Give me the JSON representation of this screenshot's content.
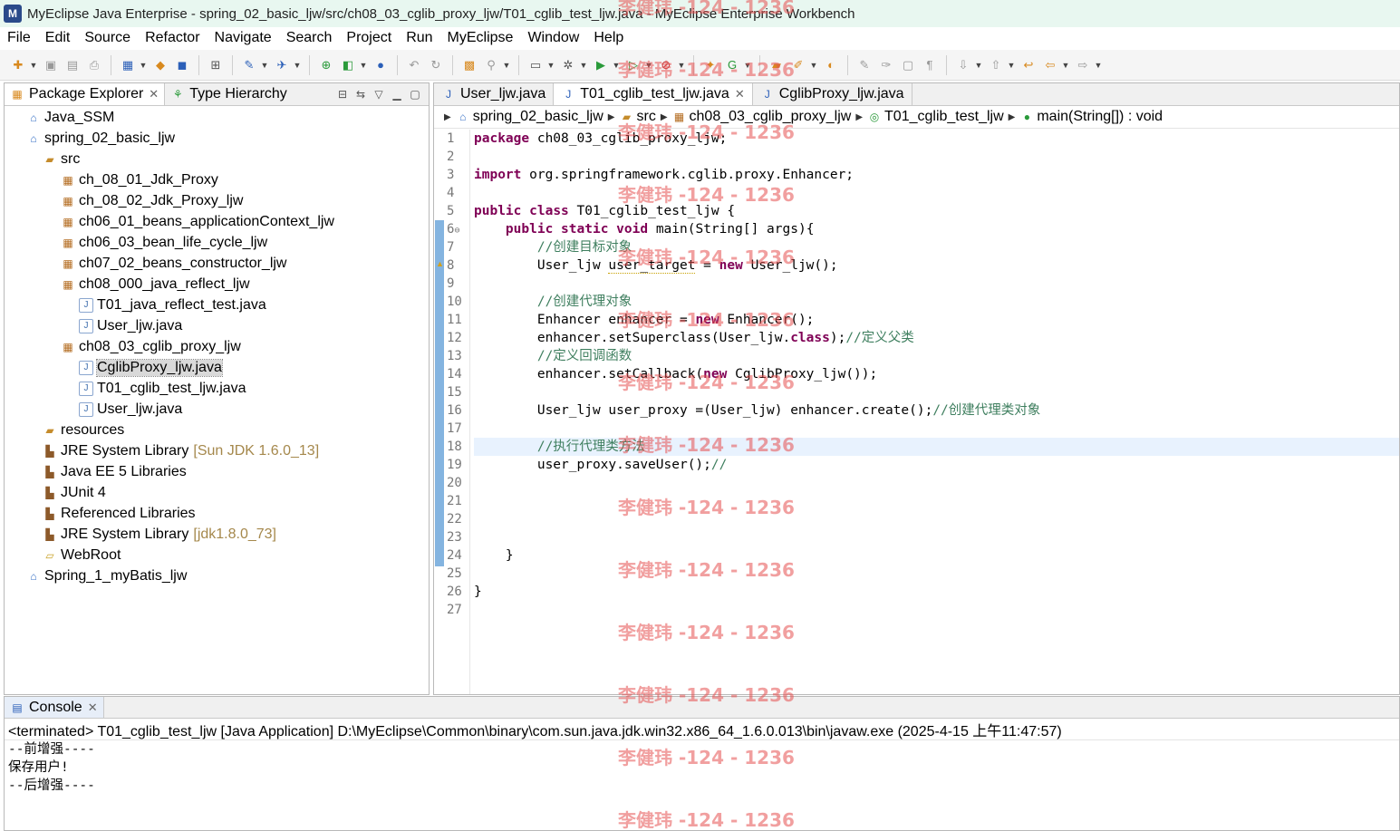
{
  "window": {
    "title": "MyEclipse Java Enterprise - spring_02_basic_ljw/src/ch08_03_cglib_proxy_ljw/T01_cglib_test_ljw.java - MyEclipse Enterprise Workbench"
  },
  "menu": [
    "File",
    "Edit",
    "Source",
    "Refactor",
    "Navigate",
    "Search",
    "Project",
    "Run",
    "MyEclipse",
    "Window",
    "Help"
  ],
  "left_view": {
    "tabs": [
      {
        "label": "Package Explorer",
        "icon": "package-explorer-icon",
        "active": true
      },
      {
        "label": "Type Hierarchy",
        "icon": "type-hierarchy-icon",
        "active": false
      }
    ],
    "tree": [
      {
        "label": "Java_SSM",
        "icon": "project-icon",
        "level": 0
      },
      {
        "label": "spring_02_basic_ljw",
        "icon": "project-icon",
        "level": 0
      },
      {
        "label": "src",
        "icon": "source-folder-icon",
        "level": 1
      },
      {
        "label": "ch_08_01_Jdk_Proxy",
        "icon": "package-icon",
        "level": 2
      },
      {
        "label": "ch_08_02_Jdk_Proxy_ljw",
        "icon": "package-icon",
        "level": 2
      },
      {
        "label": "ch06_01_beans_applicationContext_ljw",
        "icon": "package-icon",
        "level": 2
      },
      {
        "label": "ch06_03_bean_life_cycle_ljw",
        "icon": "package-icon",
        "level": 2
      },
      {
        "label": "ch07_02_beans_constructor_ljw",
        "icon": "package-icon",
        "level": 2
      },
      {
        "label": "ch08_000_java_reflect_ljw",
        "icon": "package-icon",
        "level": 2
      },
      {
        "label": "T01_java_reflect_test.java",
        "icon": "java-file-icon",
        "level": 3
      },
      {
        "label": "User_ljw.java",
        "icon": "java-file-icon",
        "level": 3
      },
      {
        "label": "ch08_03_cglib_proxy_ljw",
        "icon": "package-icon",
        "level": 2
      },
      {
        "label": "CglibProxy_ljw.java",
        "icon": "java-file-icon",
        "level": 3,
        "selected": true
      },
      {
        "label": "T01_cglib_test_ljw.java",
        "icon": "java-file-icon",
        "level": 3
      },
      {
        "label": "User_ljw.java",
        "icon": "java-file-icon",
        "level": 3
      },
      {
        "label": "resources",
        "icon": "source-folder-icon",
        "level": 1
      },
      {
        "label": "JRE System Library",
        "decor": "[Sun JDK 1.6.0_13]",
        "icon": "library-icon",
        "level": 1
      },
      {
        "label": "Java EE 5 Libraries",
        "icon": "library-icon",
        "level": 1
      },
      {
        "label": "JUnit 4",
        "icon": "library-icon",
        "level": 1
      },
      {
        "label": "Referenced Libraries",
        "icon": "library-icon",
        "level": 1
      },
      {
        "label": "JRE System Library",
        "decor": "[jdk1.8.0_73]",
        "icon": "library-icon",
        "level": 1
      },
      {
        "label": "WebRoot",
        "icon": "folder-icon",
        "level": 1
      },
      {
        "label": "Spring_1_myBatis_ljw",
        "icon": "project-icon",
        "level": 0
      }
    ]
  },
  "editor": {
    "tabs": [
      {
        "label": "User_ljw.java",
        "active": false
      },
      {
        "label": "T01_cglib_test_ljw.java",
        "active": true
      },
      {
        "label": "CglibProxy_ljw.java",
        "active": false
      }
    ],
    "breadcrumb": [
      "spring_02_basic_ljw",
      "src",
      "ch08_03_cglib_proxy_ljw",
      "T01_cglib_test_ljw",
      "main(String[]) : void"
    ],
    "line_numbers": [
      "1",
      "2",
      "3",
      "4",
      "5",
      "6",
      "7",
      "8",
      "9",
      "10",
      "11",
      "12",
      "13",
      "14",
      "15",
      "16",
      "17",
      "18",
      "19",
      "20",
      "21",
      "22",
      "23",
      "24",
      "25",
      "26",
      "27"
    ],
    "fold_marker_line": "6",
    "current_line": "18"
  },
  "console": {
    "tab_label": "Console",
    "status": "<terminated> T01_cglib_test_ljw [Java Application] D:\\MyEclipse\\Common\\binary\\com.sun.java.jdk.win32.x86_64_1.6.0.013\\bin\\javaw.exe (2025-4-15 上午11:47:57)",
    "output": [
      "--前增强----",
      "保存用户!",
      "--后增强----"
    ]
  },
  "watermark": "李健玮 -124 - 1236",
  "colors": {
    "keyword": "#7f0055",
    "comment": "#3f7f5f",
    "current_line": "#e8f2fe",
    "watermark": "#e65050"
  }
}
